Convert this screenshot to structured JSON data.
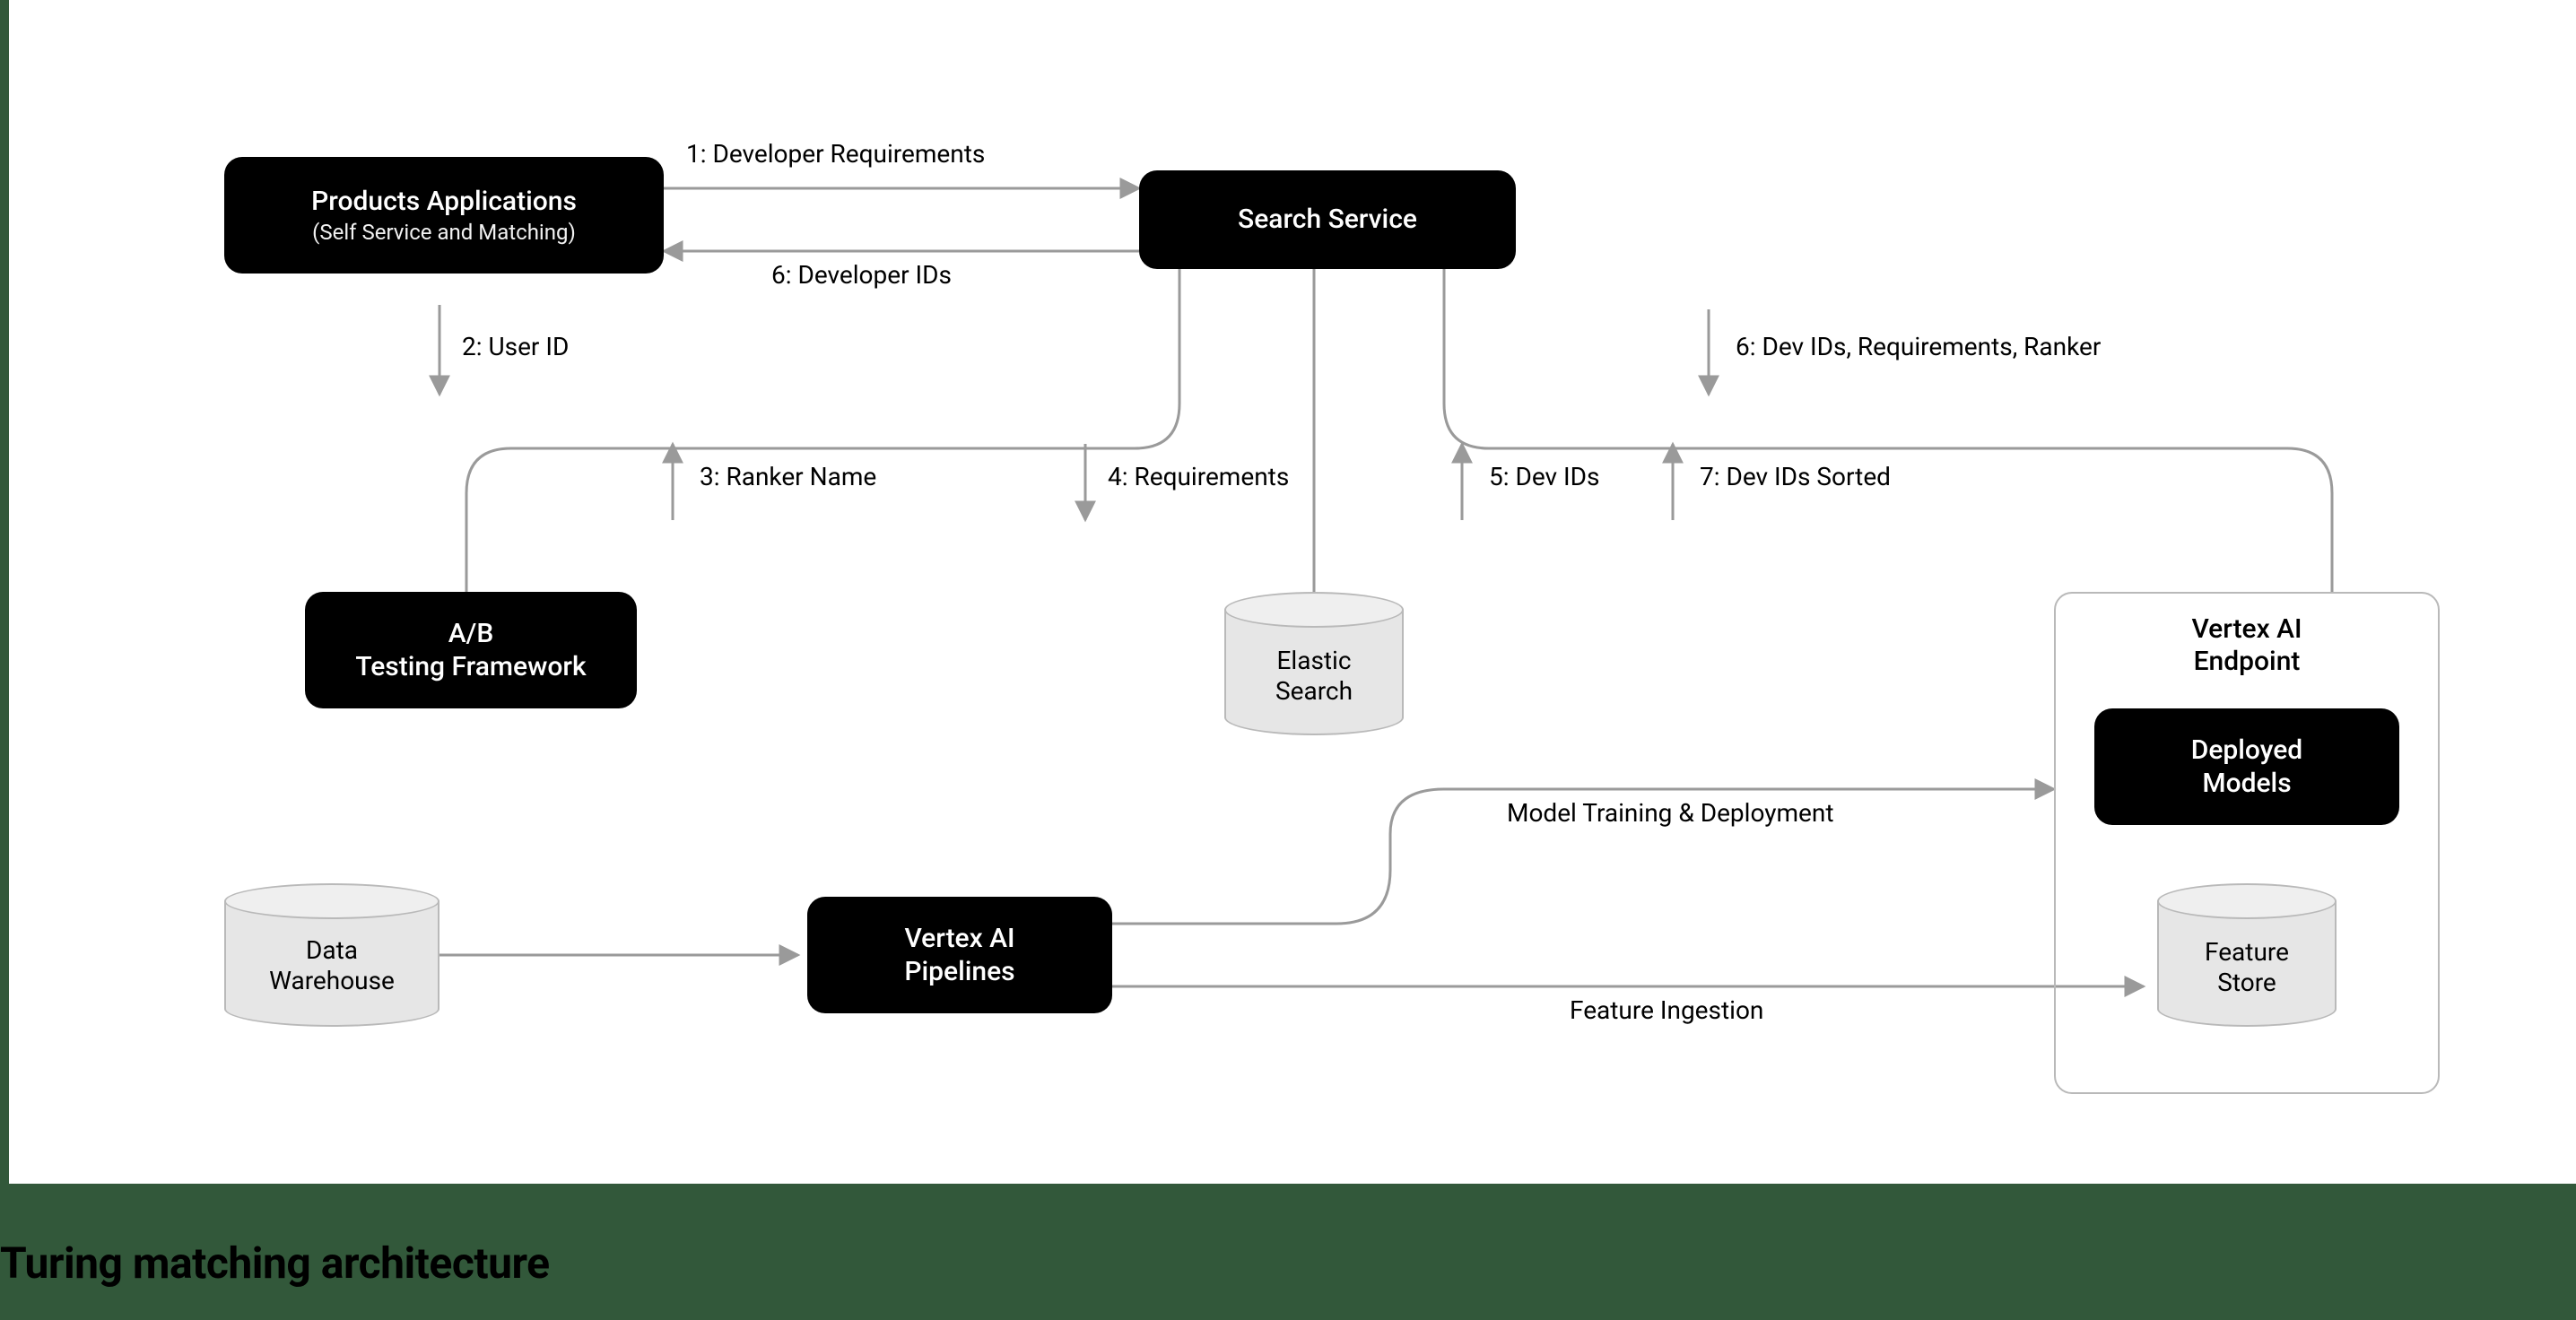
{
  "caption": "Turing matching architecture",
  "nodes": {
    "products": {
      "title": "Products Applications",
      "subtitle": "(Self Service and Matching)"
    },
    "search": {
      "title": "Search Service"
    },
    "ab": {
      "line1": "A/B",
      "line2": "Testing Framework"
    },
    "elastic": {
      "line1": "Elastic",
      "line2": "Search"
    },
    "vertex_group": {
      "line1": "Vertex AI",
      "line2": "Endpoint"
    },
    "deployed": {
      "line1": "Deployed",
      "line2": "Models"
    },
    "feature_store": {
      "line1": "Feature",
      "line2": "Store"
    },
    "warehouse": {
      "line1": "Data",
      "line2": "Warehouse"
    },
    "pipelines": {
      "line1": "Vertex AI",
      "line2": "Pipelines"
    }
  },
  "edges": {
    "e1": "1: Developer Requirements",
    "e6top": "6: Developer IDs",
    "e2": "2: User ID",
    "e3": "3: Ranker Name",
    "e4": "4: Requirements",
    "e5": "5: Dev IDs",
    "e6right": "6: Dev IDs, Requirements, Ranker",
    "e7": "7: Dev IDs Sorted",
    "mtd": "Model Training & Deployment",
    "fi": "Feature Ingestion"
  }
}
